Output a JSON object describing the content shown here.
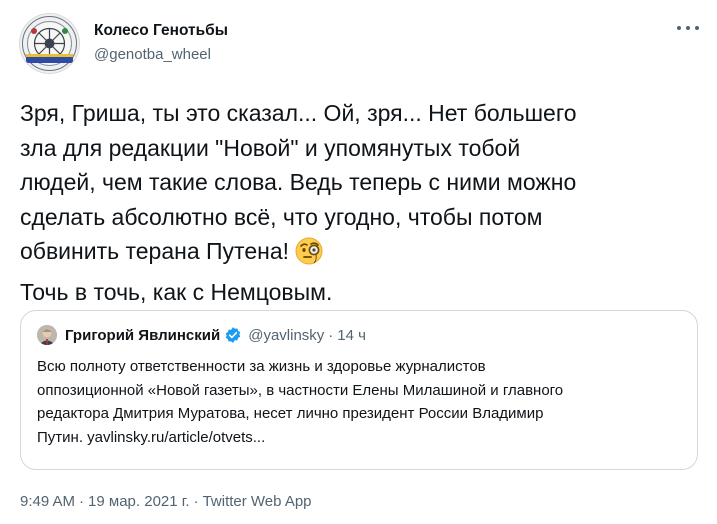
{
  "author": {
    "name": "Колесо Генотьбы",
    "handle": "@genotba_wheel"
  },
  "tweet": {
    "lines": [
      "Зря, Гриша, ты это сказал... Ой, зря... Нет большего",
      "зла для редакции \"Новой\" и упомянутых тобой",
      "людей, чем такие слова. Ведь теперь с ними можно",
      "сделать абсолютно всё, что угодно, чтобы потом",
      "обвинить терана Путена!",
      "Точь в точь, как с Немцовым."
    ],
    "emoji": "face-with-monocle-icon"
  },
  "quote": {
    "name": "Григорий Явлинский",
    "handle": "@yavlinsky",
    "time": "14 ч",
    "lines": [
      "Всю полноту ответственности за жизнь и здоровье журналистов",
      "оппозиционной «Новой газеты», в частности Елены Милашиной и главного",
      "редактора Дмитрия Муратова, несет лично президент России Владимир",
      "Путин. yavlinsky.ru/article/otvets..."
    ]
  },
  "meta": {
    "time": "9:49 AM",
    "date": "19 мар. 2021 г.",
    "app": "Twitter Web App",
    "separator": "·"
  },
  "colors": {
    "text": "#0f1419",
    "secondary": "#536471",
    "border": "#cfd9de",
    "verified": "#1d9bf0"
  }
}
